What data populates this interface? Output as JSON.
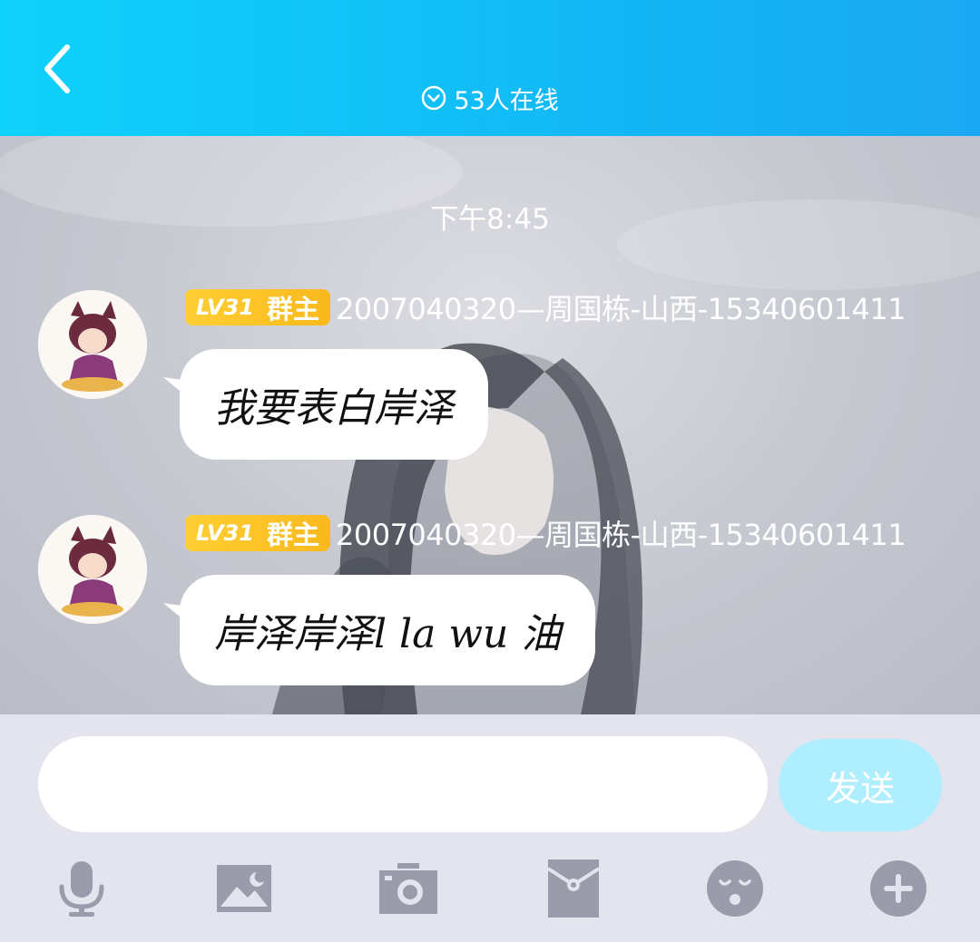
{
  "header": {
    "back_icon": "chevron-left-icon",
    "online_icon": "chevron-down-circle-icon",
    "online_text": "53人在线"
  },
  "chat": {
    "timestamp": "下午8:45",
    "messages": [
      {
        "badge_level": "LV31",
        "badge_role": "群主",
        "sender": "2007040320—周国栋-山西-15340601411",
        "text": "我要表白岸泽"
      },
      {
        "badge_level": "LV31",
        "badge_role": "群主",
        "sender": "2007040320—周国栋-山西-15340601411",
        "text": "岸泽岸泽l la wu 油"
      }
    ]
  },
  "input": {
    "value": "",
    "send_label": "发送"
  },
  "toolbar": {
    "icons": [
      "microphone-icon",
      "image-icon",
      "camera-icon",
      "red-packet-icon",
      "emoji-icon",
      "plus-icon"
    ]
  },
  "colors": {
    "header_start": "#0fd2fb",
    "header_end": "#1aa8f2",
    "badge": "#f9b91d",
    "send_button": "#aeeefe",
    "toolbar_icon": "#9a9cab"
  }
}
